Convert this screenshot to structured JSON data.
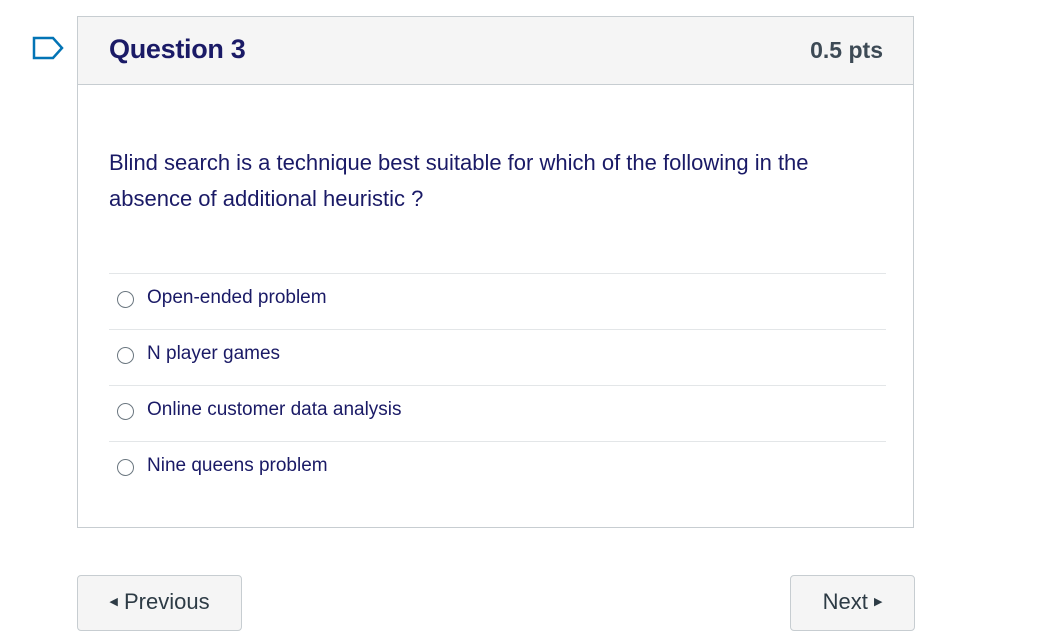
{
  "question": {
    "title": "Question 3",
    "points": "0.5 pts",
    "text": "Blind search is a technique best suitable for which of the following in the absence of additional heuristic ?",
    "answers": [
      {
        "label": "Open-ended problem",
        "selected": false
      },
      {
        "label": "N player games",
        "selected": false
      },
      {
        "label": "Online customer data analysis",
        "selected": false
      },
      {
        "label": "Nine queens problem",
        "selected": false
      }
    ]
  },
  "nav": {
    "previous_label": "Previous",
    "next_label": "Next"
  },
  "icons": {
    "flag": "flag-icon",
    "prev_arrow": "caret-left-icon",
    "next_arrow": "caret-right-icon"
  },
  "colors": {
    "question_text": "#1a1a66",
    "flag": "#0374b5"
  }
}
